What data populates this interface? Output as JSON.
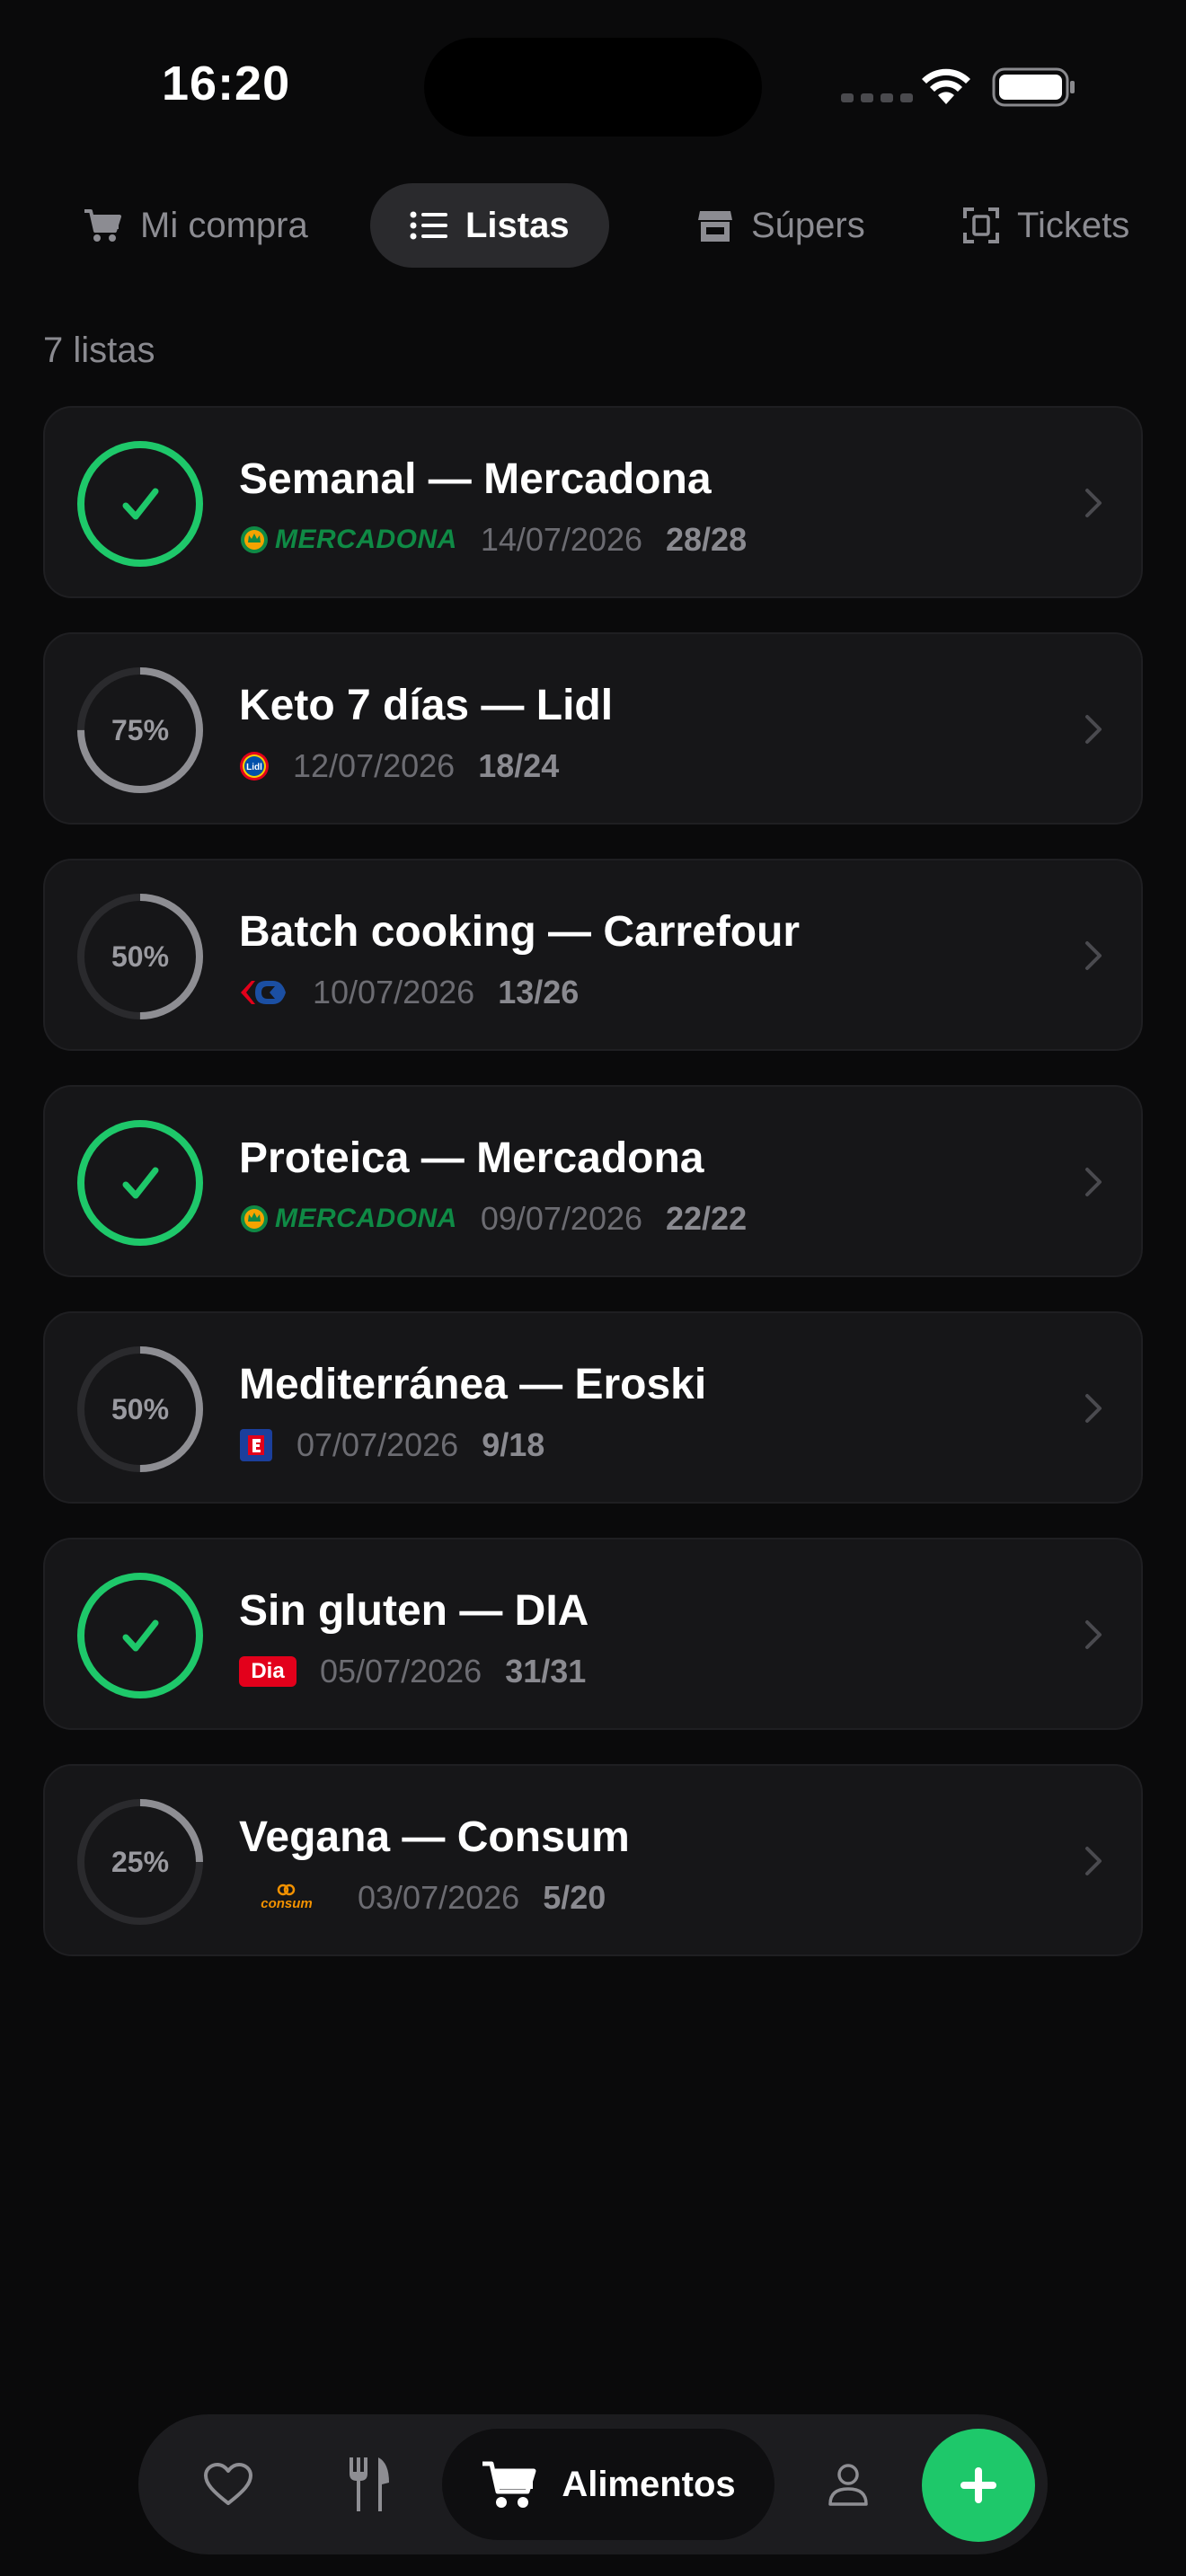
{
  "status_bar": {
    "time": "16:20"
  },
  "tabs": [
    {
      "label": "Mi compra",
      "icon": "cart-icon",
      "active": false
    },
    {
      "label": "Listas",
      "icon": "list-icon",
      "active": true
    },
    {
      "label": "Súpers",
      "icon": "store-icon",
      "active": false
    },
    {
      "label": "Tickets",
      "icon": "receipt-scan-icon",
      "active": false
    }
  ],
  "list_count": "7 listas",
  "lists": [
    {
      "title": "Semanal — Mercadona",
      "store": "Mercadona",
      "logo_text": "MERCADONA",
      "date": "14/07/2026",
      "count": "28/28",
      "progress": 1.0,
      "complete": true
    },
    {
      "title": "Keto 7 días — Lidl",
      "store": "Lidl",
      "logo_text": "Lidl",
      "date": "12/07/2026",
      "count": "18/24",
      "progress": 0.75,
      "progress_label": "75%",
      "complete": false
    },
    {
      "title": "Batch cooking — Carrefour",
      "store": "Carrefour",
      "date": "10/07/2026",
      "count": "13/26",
      "progress": 0.5,
      "progress_label": "50%",
      "complete": false
    },
    {
      "title": "Proteica — Mercadona",
      "store": "Mercadona",
      "logo_text": "MERCADONA",
      "date": "09/07/2026",
      "count": "22/22",
      "progress": 1.0,
      "complete": true
    },
    {
      "title": "Mediterránea — Eroski",
      "store": "Eroski",
      "date": "07/07/2026",
      "count": "9/18",
      "progress": 0.5,
      "progress_label": "50%",
      "complete": false
    },
    {
      "title": "Sin gluten — DIA",
      "store": "DIA",
      "logo_text": "Dia",
      "date": "05/07/2026",
      "count": "31/31",
      "progress": 1.0,
      "complete": true
    },
    {
      "title": "Vegana — Consum",
      "store": "Consum",
      "logo_text": "consum",
      "date": "03/07/2026",
      "count": "5/20",
      "progress": 0.25,
      "progress_label": "25%",
      "complete": false
    }
  ],
  "bottom_nav": {
    "items": [
      {
        "icon": "heart-icon"
      },
      {
        "icon": "fork-knife-icon"
      },
      {
        "icon": "cart-icon",
        "label": "Alimentos",
        "active": true
      },
      {
        "icon": "person-icon"
      }
    ],
    "fab_icon": "plus-icon"
  },
  "colors": {
    "accent_green": "#1ec86a",
    "background": "#0a0a0b",
    "card": "#161618",
    "mercadona_green": "#0f8a45",
    "dia_red": "#e3001b",
    "carrefour_blue": "#1b4fa3",
    "carrefour_red": "#e2001a",
    "consum_orange": "#f29100"
  }
}
